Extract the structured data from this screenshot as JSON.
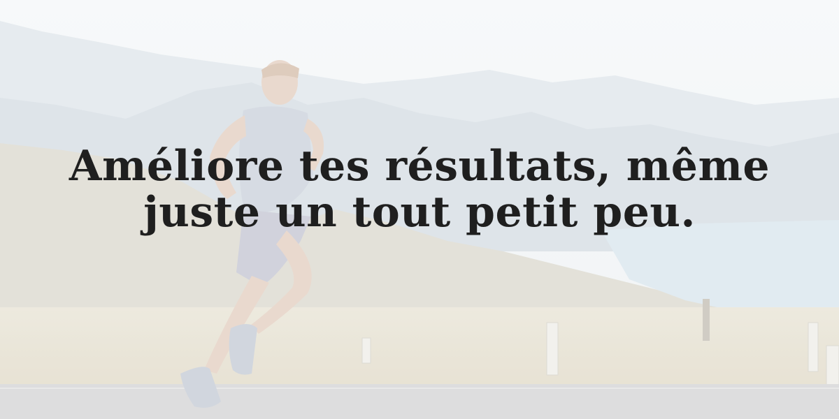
{
  "quote": {
    "line1": "Améliore tes résultats, même",
    "line2": "juste un tout petit peu."
  },
  "colors": {
    "sky": "#f2f5f7",
    "mountains_far": "#dfe6ec",
    "mountains_near": "#d4dae0",
    "lake": "#d8e6ef",
    "grass": "#e8e4d6",
    "road": "#d6d7d8",
    "text": "#1f1f1f"
  },
  "image": {
    "subject": "runner",
    "setting": "mountain road by a lake"
  }
}
